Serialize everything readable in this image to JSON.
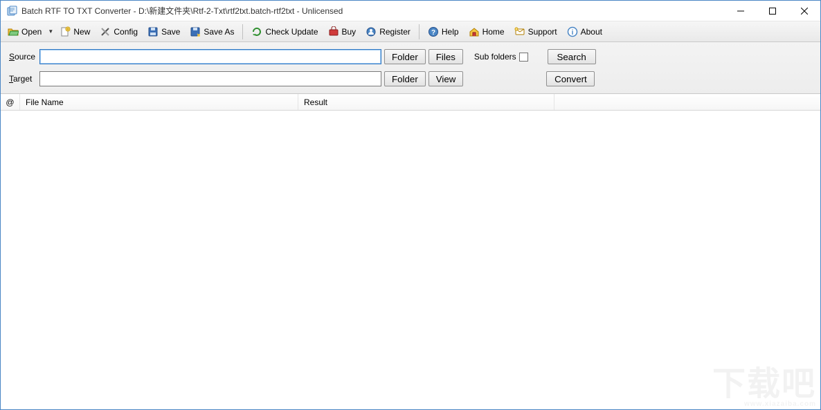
{
  "window": {
    "title": "Batch RTF TO TXT Converter - D:\\新建文件夹\\Rtf-2-Txt\\rtf2txt.batch-rtf2txt - Unlicensed"
  },
  "toolbar": {
    "open": "Open",
    "new": "New",
    "config": "Config",
    "save": "Save",
    "saveAs": "Save As",
    "checkUpdate": "Check Update",
    "buy": "Buy",
    "register": "Register",
    "help": "Help",
    "home": "Home",
    "support": "Support",
    "about": "About"
  },
  "form": {
    "sourceLabelPrefix": "S",
    "sourceLabelRest": "ource",
    "targetLabelPrefix": "T",
    "targetLabelRest": "arget",
    "sourceValue": "",
    "targetValue": "",
    "folderBtn": "Folder",
    "filesBtn": "Files",
    "viewBtn": "View",
    "subFoldersLabel": "Sub folders",
    "searchBtn": "Search",
    "convertBtn": "Convert"
  },
  "table": {
    "colAt": "@",
    "colFile": "File Name",
    "colResult": "Result"
  },
  "watermark": {
    "big": "下载吧",
    "small": "www.xiazaiba.com"
  }
}
